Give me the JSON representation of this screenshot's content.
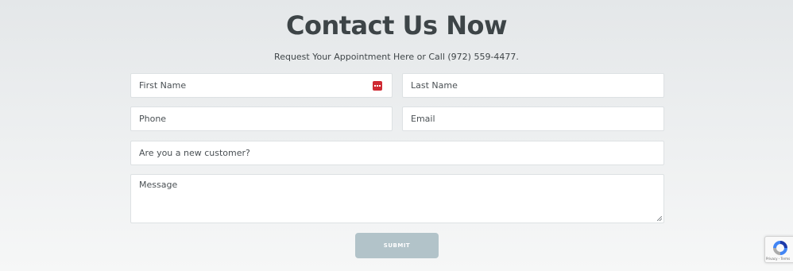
{
  "heading": "Contact Us Now",
  "subheading": "Request Your Appointment Here or Call (972) 559-4477.",
  "form": {
    "first_name": {
      "placeholder": "First Name",
      "value": ""
    },
    "last_name": {
      "placeholder": "Last Name",
      "value": ""
    },
    "phone": {
      "placeholder": "Phone",
      "value": ""
    },
    "email": {
      "placeholder": "Email",
      "value": ""
    },
    "new_customer": {
      "placeholder": "Are you a new customer?",
      "value": ""
    },
    "message": {
      "placeholder": "Message",
      "value": ""
    },
    "submit_label": "SUBMIT"
  },
  "recaptcha": {
    "icon": "recaptcha-icon",
    "links_text": "Privacy - Terms"
  },
  "colors": {
    "heading": "#3d4447",
    "submit_bg": "#b2c3c9",
    "autofill_icon": "#cf2a33"
  }
}
